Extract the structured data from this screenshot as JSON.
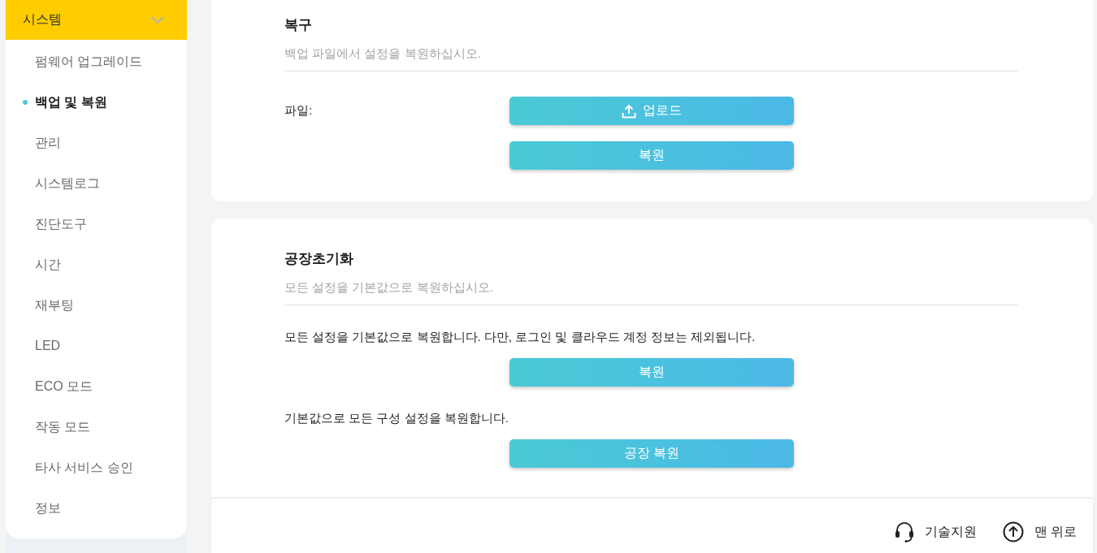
{
  "sidebar": {
    "section": {
      "label": "시스템",
      "expanded": true
    },
    "items": [
      {
        "label": "펌웨어 업그레이드",
        "selected": false
      },
      {
        "label": "백업 및 복원",
        "selected": true
      },
      {
        "label": "관리",
        "selected": false
      },
      {
        "label": "시스템로그",
        "selected": false
      },
      {
        "label": "진단도구",
        "selected": false
      },
      {
        "label": "시간",
        "selected": false
      },
      {
        "label": "재부팅",
        "selected": false
      },
      {
        "label": "LED",
        "selected": false
      },
      {
        "label": "ECO 모드",
        "selected": false
      },
      {
        "label": "작동 모드",
        "selected": false
      },
      {
        "label": "타사 서비스 승인",
        "selected": false
      },
      {
        "label": "정보",
        "selected": false
      }
    ]
  },
  "sections": [
    {
      "title": "복구",
      "subtitle": "백업 파일에서 설정을 복원하십시오.",
      "items": [
        {
          "kind": "upload",
          "label": "파일:",
          "button": "업로드"
        },
        {
          "kind": "action",
          "button": "복원"
        }
      ]
    },
    {
      "title": "공장초기화",
      "subtitle": "모든 설정을 기본값으로 복원하십시오.",
      "items": [
        {
          "kind": "note",
          "text": "모든 설정을 기본값으로 복원합니다. 다만, 로그인 및 클라우드 계정 정보는 제외됩니다."
        },
        {
          "kind": "action",
          "button": "복원"
        },
        {
          "kind": "note",
          "text": "기본값으로 모든 구성 설정을 복원합니다."
        },
        {
          "kind": "action",
          "button": "공장 복원"
        }
      ]
    }
  ],
  "footer": {
    "links": [
      {
        "kind": "support",
        "label": "기술지원"
      },
      {
        "kind": "top",
        "label": "맨 위로"
      }
    ]
  }
}
